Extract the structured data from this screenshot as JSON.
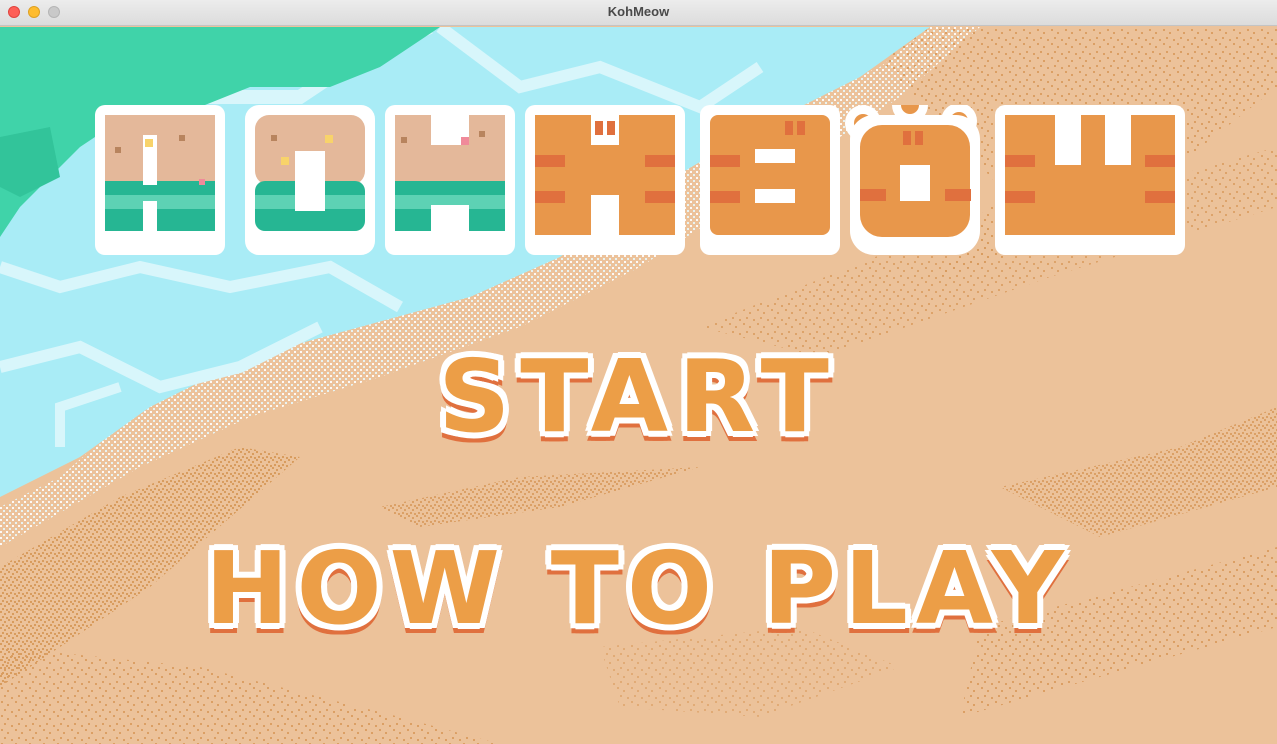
{
  "window": {
    "title": "KohMeow"
  },
  "game": {
    "logo_text": "KOHMEOW",
    "logo_letters": [
      "K",
      "O",
      "H",
      "M",
      "E",
      "O",
      "W"
    ],
    "menu": {
      "start_label": "START",
      "how_to_play_label": "HOW TO PLAY"
    }
  },
  "colors": {
    "sea_deep": "#40d3a9",
    "sea_shallow": "#a9ecf6",
    "foam": "#d8f6fb",
    "sand": "#ecc29a",
    "sand_speckle": "#d99b5e",
    "button_fill": "#ec9e47",
    "button_outline": "#ffffff",
    "button_shadow": "#e0703e",
    "logo_island_top": "#e4b89a",
    "logo_island_bottom": "#26b693",
    "logo_cat_fill": "#e8974b",
    "logo_cat_stripe": "#e0703e"
  }
}
